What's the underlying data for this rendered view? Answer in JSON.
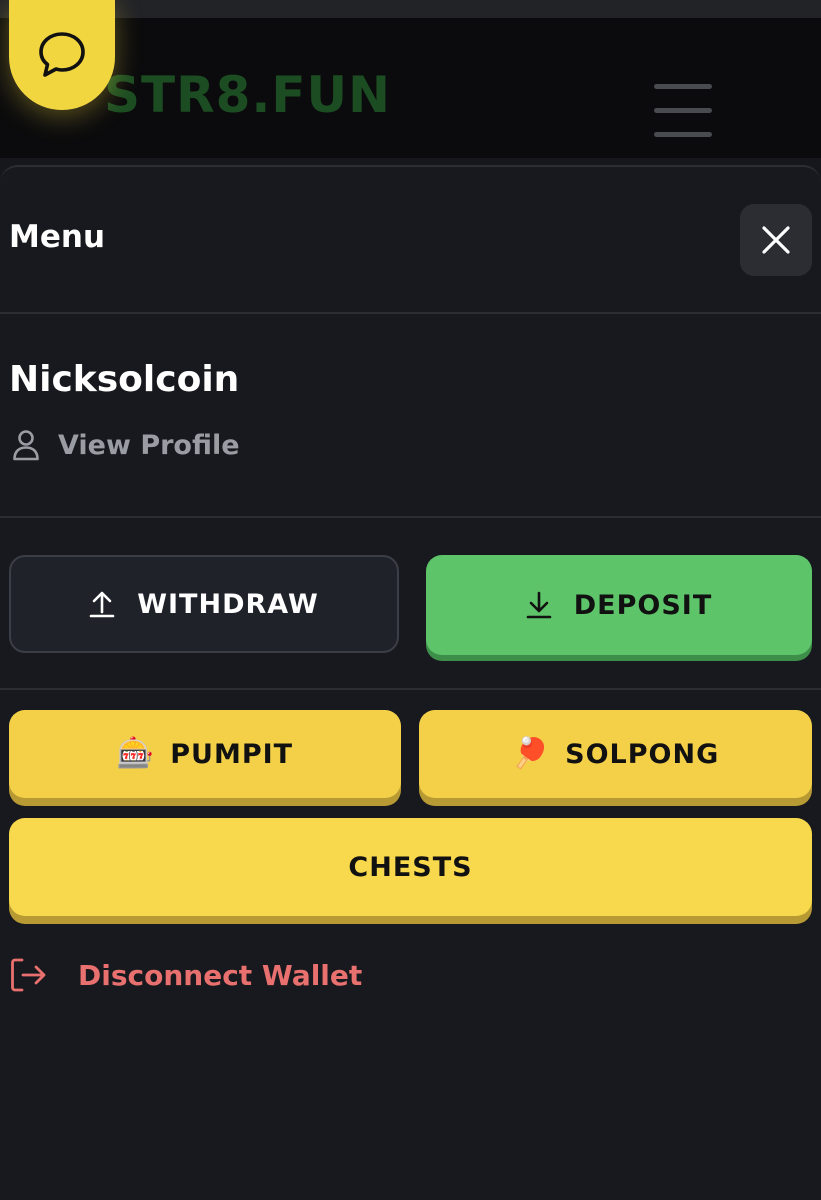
{
  "header": {
    "logo_text": "STR8.FUN",
    "chat_icon": "chat-bubble-icon",
    "menu_icon": "hamburger-icon"
  },
  "drawer": {
    "title": "Menu",
    "close_icon": "close-icon",
    "user": {
      "username": "Nicksolcoin",
      "view_profile_label": "View Profile",
      "profile_icon": "user-icon"
    },
    "actions": {
      "withdraw_label": "WITHDRAW",
      "withdraw_icon": "upload-icon",
      "deposit_label": "DEPOSIT",
      "deposit_icon": "download-icon"
    },
    "games": [
      {
        "label": "PUMPIT",
        "emoji": "🎰",
        "icon": "slot-machine-icon"
      },
      {
        "label": "SOLPONG",
        "emoji": "🏓",
        "icon": "ping-pong-icon"
      },
      {
        "label": "CHESTS"
      }
    ],
    "disconnect_label": "Disconnect Wallet",
    "disconnect_icon": "logout-icon"
  },
  "colors": {
    "background": "#16171c",
    "accent_yellow": "#f4d048",
    "accent_green": "#5dc46a",
    "danger": "#e8706e",
    "logo_green": "#1c4d22"
  }
}
